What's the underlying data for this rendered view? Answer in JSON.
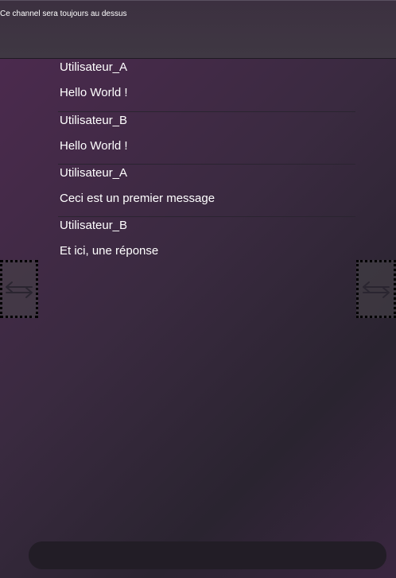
{
  "header": {
    "channel_title": "Ce channel sera toujours au dessus"
  },
  "messages": [
    {
      "author": "Utilisateur_A",
      "text": "Hello World !"
    },
    {
      "author": "Utilisateur_B",
      "text": "Hello World !"
    },
    {
      "author": "Utilisateur_A",
      "text": "Ceci est un premier message"
    },
    {
      "author": "Utilisateur_B",
      "text": "Et ici, une réponse"
    }
  ],
  "nav": {
    "left_icon": "swap-arrows-icon",
    "right_icon": "swap-arrows-icon"
  },
  "input": {
    "value": "",
    "placeholder": ""
  },
  "colors": {
    "background_top": "#4e2a50",
    "background_bottom": "#2a2430",
    "header": "#3f3843",
    "input": "#221d26",
    "text": "#ffffff"
  }
}
